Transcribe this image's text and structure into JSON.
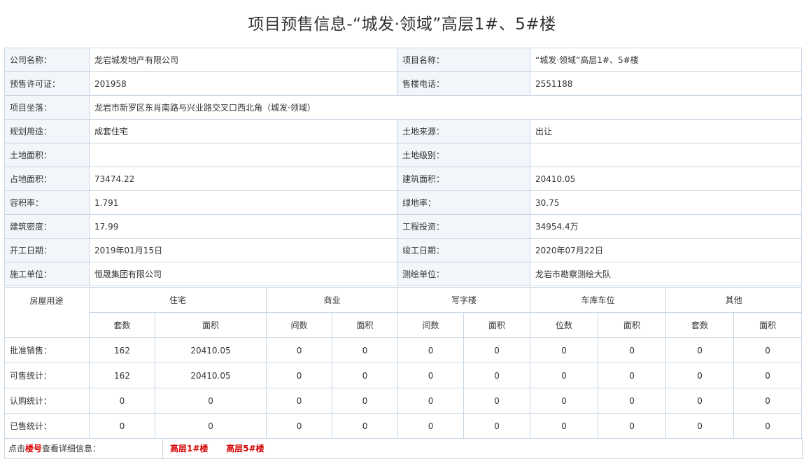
{
  "page_title": "项目预售信息-“城发·领域”高层1#、5#楼",
  "info": {
    "company_label": "公司名称：",
    "company": "龙岩城发地产有限公司",
    "project_label": "项目名称：",
    "project": "“城发·领域”高层1#、5#楼",
    "permit_label": "预售许可证：",
    "permit": "201958",
    "phone_label": "售楼电话：",
    "phone": "2551188",
    "location_label": "项目坐落：",
    "location": "龙岩市新罗区东肖南路与兴业路交叉口西北角（城发·领域）",
    "usage_label": "规划用途：",
    "usage": "成套住宅",
    "land_source_label": "土地来源：",
    "land_source": "出让",
    "land_area_label": "土地面积：",
    "land_area": "",
    "land_grade_label": "土地级别：",
    "land_grade": "",
    "site_area_label": "占地面积：",
    "site_area": "73474.22",
    "build_area_label": "建筑面积：",
    "build_area": "20410.05",
    "far_label": "容积率：",
    "far": "1.791",
    "green_label": "绿地率：",
    "green": "30.75",
    "density_label": "建筑密度：",
    "density": "17.99",
    "invest_label": "工程投资：",
    "invest": "34954.4万",
    "start_label": "开工日期：",
    "start": "2019年01月15日",
    "finish_label": "竣工日期：",
    "finish": "2020年07月22日",
    "builder_label": "施工单位：",
    "builder": "恒晟集团有限公司",
    "surveyor_label": "测绘单位：",
    "surveyor": "龙岩市勘察测绘大队"
  },
  "stats": {
    "row_head": "房屋用途",
    "groups": [
      "住宅",
      "商业",
      "写字楼",
      "车库车位",
      "其他"
    ],
    "subheads": [
      "套数",
      "面积",
      "间数",
      "面积",
      "间数",
      "面积",
      "位数",
      "面积",
      "套数",
      "面积"
    ],
    "rows": [
      {
        "label": "批准销售：",
        "values": [
          "162",
          "20410.05",
          "0",
          "0",
          "0",
          "0",
          "0",
          "0",
          "0",
          "0"
        ]
      },
      {
        "label": "可售统计：",
        "values": [
          "162",
          "20410.05",
          "0",
          "0",
          "0",
          "0",
          "0",
          "0",
          "0",
          "0"
        ]
      },
      {
        "label": "认购统计：",
        "values": [
          "0",
          "0",
          "0",
          "0",
          "0",
          "0",
          "0",
          "0",
          "0",
          "0"
        ]
      },
      {
        "label": "已售统计：",
        "values": [
          "0",
          "0",
          "0",
          "0",
          "0",
          "0",
          "0",
          "0",
          "0",
          "0"
        ]
      }
    ]
  },
  "footer": {
    "prefix": "点击",
    "highlight": "楼号",
    "suffix": "查看详细信息：",
    "buildings": [
      "高层1#楼",
      "高层5#楼"
    ]
  }
}
